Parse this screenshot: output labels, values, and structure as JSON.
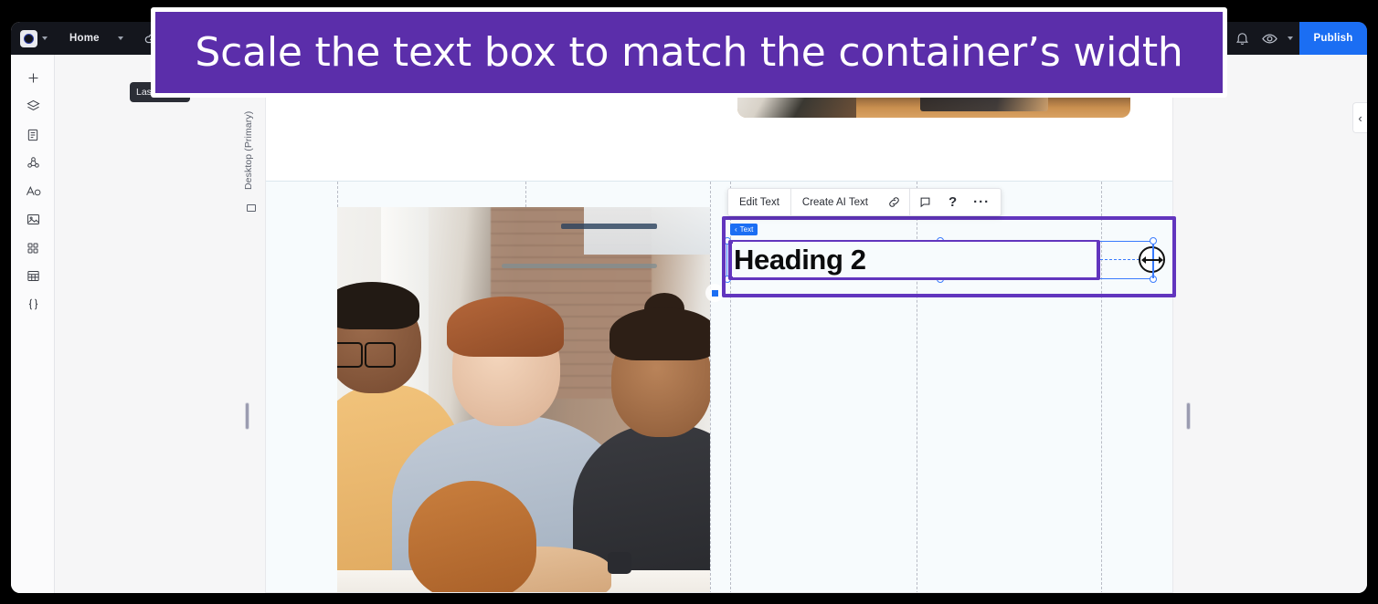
{
  "banner": {
    "text": "Scale the text box to match the container’s width",
    "bg": "#5b2eaa"
  },
  "topbar": {
    "logo_name": "app-logo",
    "nav": {
      "home_label": "Home"
    },
    "save_icon": "cloud-check-icon",
    "right_icons": [
      "redo-arrow-icon",
      "bell-icon",
      "eye-icon",
      "chevron-down-icon"
    ],
    "publish_label": "Publish",
    "publish_color": "#1b6ef3"
  },
  "tooltip": {
    "text": "Last sa"
  },
  "rail": {
    "items": [
      {
        "name": "add-icon",
        "label": "Add"
      },
      {
        "name": "layers-icon",
        "label": "Layers"
      },
      {
        "name": "pages-icon",
        "label": "Pages"
      },
      {
        "name": "components-icon",
        "label": "Components"
      },
      {
        "name": "typography-icon",
        "label": "Typography"
      },
      {
        "name": "assets-image-icon",
        "label": "Assets"
      },
      {
        "name": "apps-grid-icon",
        "label": "Apps"
      },
      {
        "name": "table-icon",
        "label": "Table"
      },
      {
        "name": "code-braces-icon",
        "label": "Code"
      }
    ]
  },
  "workspace": {
    "breakpoint_label": "Desktop (Primary)",
    "breakpoint_icon": "monitor-icon"
  },
  "selection": {
    "badge_label": "Text",
    "badge_chevron": "‹",
    "element_text": "Heading 2",
    "outline_color": "#6235be",
    "handle_color": "#3a7bfd",
    "cursor": "horizontal-resize-cursor"
  },
  "context_toolbar": {
    "buttons": [
      {
        "name": "edit-text-button",
        "label": "Edit Text"
      },
      {
        "name": "create-ai-text-button",
        "label": "Create AI Text"
      }
    ],
    "icons": [
      {
        "name": "link-icon"
      },
      {
        "name": "comment-icon"
      },
      {
        "name": "help-icon",
        "glyph": "?"
      },
      {
        "name": "more-options-icon",
        "glyph": "···"
      }
    ]
  },
  "panel": {
    "collapse_glyph": "‹"
  }
}
